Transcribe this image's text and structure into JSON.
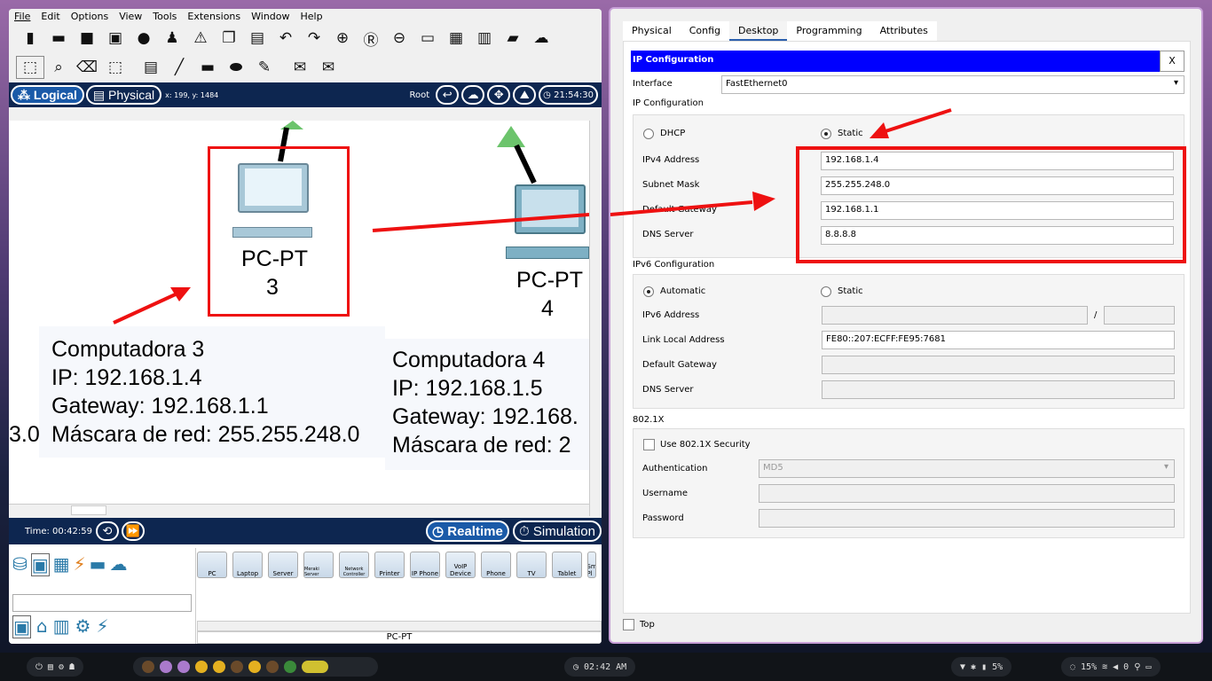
{
  "menu": [
    "File",
    "Edit",
    "Options",
    "View",
    "Tools",
    "Extensions",
    "Window",
    "Help"
  ],
  "viewbar": {
    "logical": "Logical",
    "physical": "Physical",
    "coords": "x: 199, y: 1484",
    "root": "Root",
    "time": "21:54:30"
  },
  "canvas": {
    "pc3": {
      "name1": "PC-PT",
      "name2": "3"
    },
    "pc4": {
      "name1": "PC-PT",
      "name2": "4"
    },
    "note3": [
      "Computadora 3",
      "IP: 192.168.1.4",
      "Gateway: 192.168.1.1",
      "Máscara de red: 255.255.248.0"
    ],
    "note4": [
      "Computadora 4",
      "IP: 192.168.1.5",
      "Gateway: 192.168.",
      "Máscara de red: 2"
    ],
    "partial_left": "3.0"
  },
  "timebar": {
    "time": "Time: 00:42:59",
    "realtime": "Realtime",
    "simulation": "Simulation"
  },
  "devices": [
    "PC",
    "Laptop",
    "Server",
    "Meraki Server",
    "Network Controller",
    "Printer",
    "IP Phone",
    "VoIP Device",
    "Phone",
    "TV",
    "Tablet",
    "Sm Pl"
  ],
  "device_label": "PC-PT",
  "config": {
    "tabs": [
      "Physical",
      "Config",
      "Desktop",
      "Programming",
      "Attributes"
    ],
    "selected_tab": "Desktop",
    "title": "IP Configuration",
    "close": "X",
    "interface_label": "Interface",
    "interface_value": "FastEthernet0",
    "ipv4_section": "IP Configuration",
    "dhcp": "DHCP",
    "static": "Static",
    "ipv4_label": "IPv4 Address",
    "ipv4": "192.168.1.4",
    "mask_label": "Subnet Mask",
    "mask": "255.255.248.0",
    "gw_label": "Default Gateway",
    "gw": "192.168.1.1",
    "dns_label": "DNS Server",
    "dns": "8.8.8.8",
    "ipv6_section": "IPv6 Configuration",
    "automatic": "Automatic",
    "static6": "Static",
    "ipv6_label": "IPv6 Address",
    "slash": "/",
    "lla_label": "Link Local Address",
    "lla": "FE80::207:ECFF:FE95:7681",
    "gw6_label": "Default Gateway",
    "dns6_label": "DNS Server",
    "dot1x_section": "802.1X",
    "use_dot1x": "Use 802.1X Security",
    "auth_label": "Authentication",
    "auth_value": "MD5",
    "user_label": "Username",
    "pass_label": "Password",
    "top": "Top"
  },
  "taskbar": {
    "clock": "02:42 AM",
    "battery": "5%",
    "cpu": "15%",
    "vol": "0"
  },
  "colors": {
    "title_bar": "#0000ff",
    "dark_bar": "#0d2650",
    "highlight": "#ee1111"
  }
}
